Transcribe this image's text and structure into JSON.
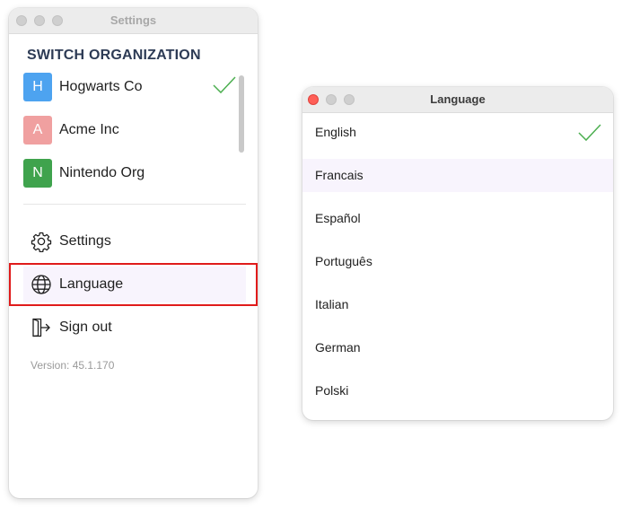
{
  "settings_window": {
    "title": "Settings",
    "section_title": "SWITCH ORGANIZATION",
    "organizations": [
      {
        "initial": "H",
        "name": "Hogwarts Co",
        "color": "#4da3f0",
        "selected": true
      },
      {
        "initial": "A",
        "name": "Acme Inc",
        "color": "#f0a0a0",
        "selected": false
      },
      {
        "initial": "N",
        "name": "Nintendo Org",
        "color": "#3fa34d",
        "selected": false
      }
    ],
    "menu": [
      {
        "label": "Settings",
        "icon": "gear-icon"
      },
      {
        "label": "Language",
        "icon": "globe-icon",
        "selected": true
      },
      {
        "label": "Sign out",
        "icon": "sign-out-icon"
      }
    ],
    "version": "Version: 45.1.170"
  },
  "language_window": {
    "title": "Language",
    "languages": [
      {
        "label": "English",
        "selected": true
      },
      {
        "label": "Francais",
        "hovered": true
      },
      {
        "label": "Español"
      },
      {
        "label": "Português"
      },
      {
        "label": "Italian"
      },
      {
        "label": "German"
      },
      {
        "label": "Polski"
      }
    ]
  },
  "colors": {
    "accent_check": "#4caf50",
    "highlight_border": "#e01b1b",
    "selected_row": "#f8f4fd",
    "section_title": "#2d3b55"
  }
}
